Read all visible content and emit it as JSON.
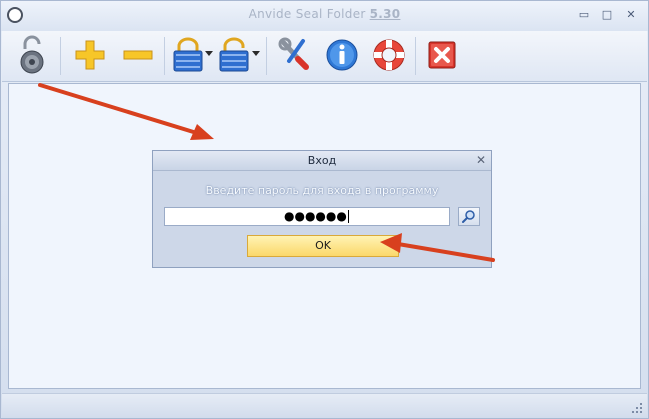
{
  "window": {
    "title": "Anvide Seal Folder",
    "version": "5.30",
    "minimize_glyph": "▭",
    "restore_glyph": "□",
    "close_glyph": "✕"
  },
  "toolbar": {
    "buttons": [
      {
        "icon": "open-lock-dial-icon"
      },
      {
        "icon": "plus-icon"
      },
      {
        "icon": "minus-icon"
      },
      {
        "icon": "lock-closed-icon"
      },
      {
        "icon": "lock-open-icon"
      },
      {
        "icon": "tools-icon"
      },
      {
        "icon": "info-icon"
      },
      {
        "icon": "lifebuoy-icon"
      },
      {
        "icon": "exit-icon"
      }
    ]
  },
  "dialog": {
    "title": "Вход",
    "close_glyph": "✕",
    "prompt": "Введите пароль для входа в программу",
    "password_mask": "●●●●●●",
    "ok_label": "OK"
  },
  "colors": {
    "accent_arrow": "#d8401e",
    "ok_button": "#fbd86a",
    "exit_red": "#d8332a"
  }
}
